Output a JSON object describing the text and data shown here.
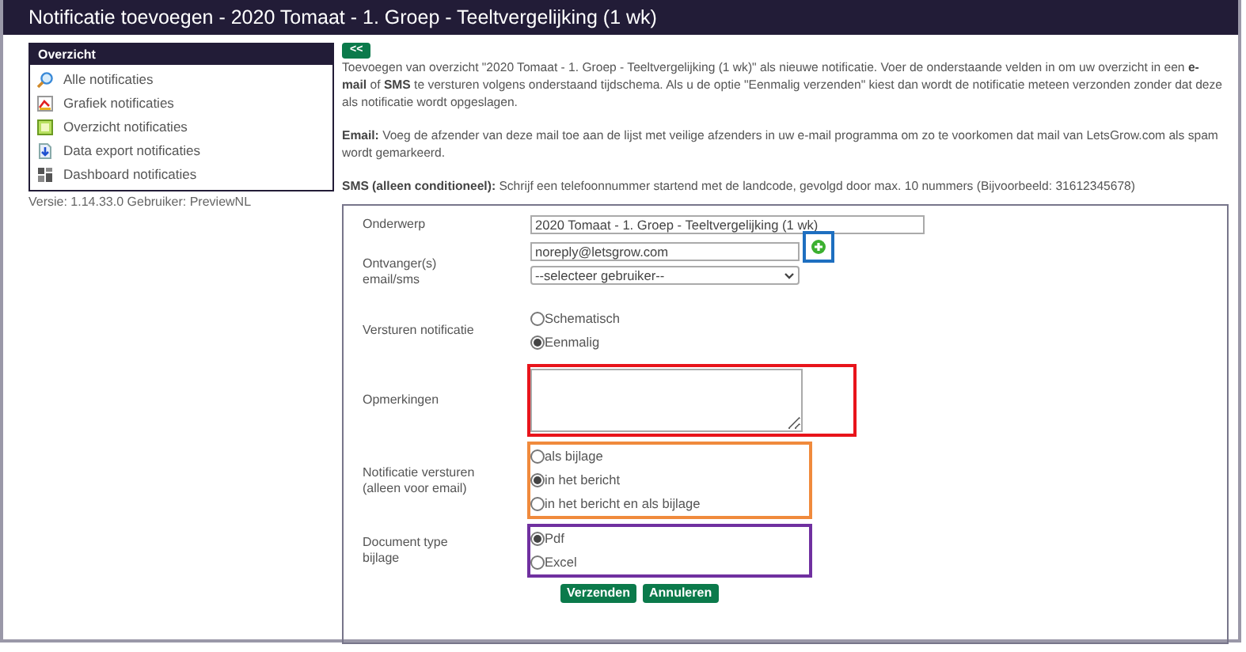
{
  "window": {
    "title": "Notificatie toevoegen  -  2020 Tomaat - 1. Groep - Teeltvergelijking (1 wk)"
  },
  "sidebar": {
    "title": "Overzicht",
    "items": [
      {
        "label": "Alle notificaties"
      },
      {
        "label": "Grafiek notificaties"
      },
      {
        "label": "Overzicht notificaties"
      },
      {
        "label": "Data export notificaties"
      },
      {
        "label": "Dashboard notificaties"
      }
    ],
    "version": "Versie: 1.14.33.0 Gebruiker: PreviewNL"
  },
  "back_button": "<<",
  "intro": [
    "Toevoegen van overzicht \"2020 Tomaat - 1. Groep - Teeltvergelijking (1 wk)\" als nieuwe notificatie. Voer de onderstaande velden in om uw overzicht in een **e-mail** of **SMS** te versturen volgens onderstaand tijdschema. Als u de optie \"Eenmalig verzenden\" kiest dan wordt de notificatie meteen verzonden zonder dat deze als notificatie wordt opgeslagen.",
    "**Email:** Voeg de afzender van deze mail toe aan de lijst met veilige afzenders in uw e-mail programma om zo te voorkomen dat mail van LetsGrow.com als spam wordt gemarkeerd.",
    "**SMS (alleen conditioneel):** Schrijf een telefoonnummer startend met de landcode, gevolgd door max. 10 nummers (Bijvoorbeeld: 31612345678)"
  ],
  "form": {
    "rows": [
      {
        "kind": "text",
        "label": "Onderwerp",
        "value": "2020 Tomaat - 1. Groep - Teeltvergelijking (1 wk)"
      },
      {
        "kind": "recipients",
        "label": "Ontvanger(s) email/sms",
        "value": "noreply@letsgrow.com",
        "select": "--selecteer gebruiker--",
        "add_button": {
          "color": "#1e6fc0"
        }
      },
      {
        "kind": "radio",
        "label": "Versturen notificatie",
        "options": [
          {
            "label": "Schematisch",
            "selected": false
          },
          {
            "label": "Eenmalig",
            "selected": true
          }
        ]
      },
      {
        "kind": "textarea",
        "label": "Opmerkingen",
        "color": "#e8141b"
      },
      {
        "kind": "radio",
        "label": "Notificatie versturen (alleen voor email)",
        "color": "#f08a3c",
        "options": [
          {
            "label": "als bijlage",
            "selected": false
          },
          {
            "label": "in het bericht",
            "selected": true
          },
          {
            "label": "in het bericht en als bijlage",
            "selected": false
          }
        ]
      },
      {
        "kind": "radio",
        "label": "Document type bijlage",
        "color": "#7030a0",
        "options": [
          {
            "label": "Pdf",
            "selected": true
          },
          {
            "label": "Excel",
            "selected": false
          }
        ]
      }
    ],
    "buttons": [
      "Verzenden",
      "Annuleren"
    ]
  }
}
